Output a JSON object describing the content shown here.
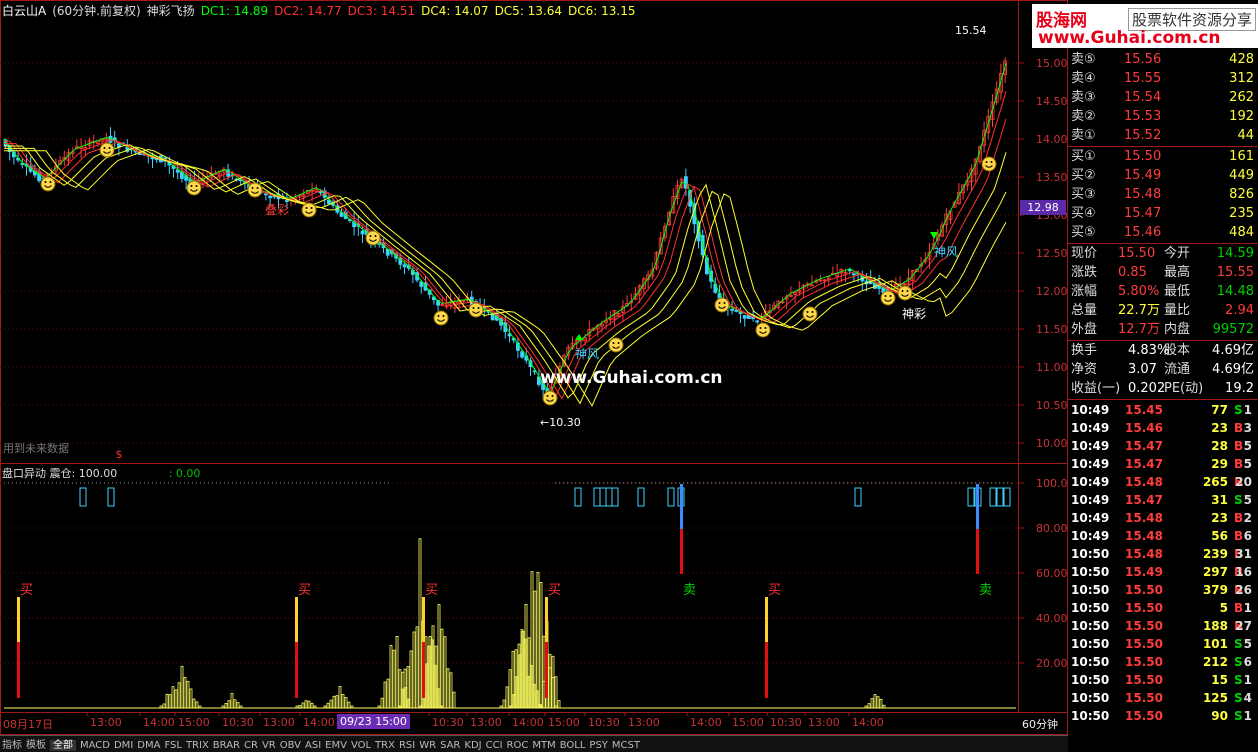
{
  "title": {
    "stock": "白云山A",
    "period": "(60分钟.前复权)",
    "indicator": "神彩飞扬",
    "dc": [
      {
        "label": "DC1: 14.89",
        "color": "#00ff00"
      },
      {
        "label": "DC2: 14.77",
        "color": "#ff3030"
      },
      {
        "label": "DC3: 14.51",
        "color": "#ff3030"
      },
      {
        "label": "DC4: 14.07",
        "color": "#ffff30"
      },
      {
        "label": "DC5: 13.64",
        "color": "#ffff30"
      },
      {
        "label": "DC6: 13.15",
        "color": "#ffff30"
      }
    ]
  },
  "price_axis": [
    "15.00",
    "14.50",
    "14.00",
    "13.50",
    "13.00",
    "12.50",
    "12.00",
    "11.50",
    "11.00",
    "10.50",
    "10.00"
  ],
  "current_price_tag": "12.98",
  "high_marker": "15.54",
  "low_marker": "←10.30",
  "chart_labels": {
    "label1": "叠彩",
    "label2": "神风",
    "label3": "神风",
    "label4": "神彩",
    "warn": "用到未来数据",
    "watermark": "www.Guhai.com.cn",
    "dollar": "$"
  },
  "indicator_panel": {
    "name": "盘口异动",
    "param": "震仓: 100.00",
    "val2": ": 0.00",
    "axis": [
      "100.00",
      "80.00",
      "60.00",
      "40.00",
      "20.00"
    ],
    "signals": [
      {
        "text": "买",
        "color": "#ff3030",
        "type": "buy"
      },
      {
        "text": "买",
        "color": "#ff3030",
        "type": "buy"
      },
      {
        "text": "买",
        "color": "#ff3030",
        "type": "buy"
      },
      {
        "text": "买",
        "color": "#ff3030",
        "type": "buy"
      },
      {
        "text": "卖",
        "color": "#00d000",
        "type": "sell"
      },
      {
        "text": "买",
        "color": "#ff3030",
        "type": "buy"
      },
      {
        "text": "卖",
        "color": "#00d000",
        "type": "sell"
      }
    ]
  },
  "time_axis": {
    "first": "08月17日",
    "labels": [
      "13:00",
      "14:00",
      "15:00",
      "10:30",
      "13:00",
      "14:00",
      "15:00",
      "10:30",
      "13:00",
      "14:00",
      "15:00",
      "10:30",
      "13:00",
      "14:00",
      "15:00",
      "10:30",
      "13:00",
      "14:00"
    ],
    "highlight": "09/23 15:00",
    "timeframe": "60分钟"
  },
  "bottom_tabs": [
    "指标",
    "模板",
    "全部",
    "MACD",
    "DMI",
    "DMA",
    "FSL",
    "TRIX",
    "BRAR",
    "CR",
    "VR",
    "OBV",
    "ASI",
    "EMV",
    "VOL",
    "TRX",
    "RSI",
    "WR",
    "SAR",
    "KDJ",
    "CCI",
    "ROC",
    "MTM",
    "BOLL",
    "PSY",
    "MCST"
  ],
  "logo": {
    "line1": "股海网",
    "line2": "股票软件资源分享",
    "line3": "www.Guhai.com.cn"
  },
  "order_book": {
    "sell": [
      {
        "label": "卖⑤",
        "price": "15.56",
        "vol": "428"
      },
      {
        "label": "卖④",
        "price": "15.55",
        "vol": "312"
      },
      {
        "label": "卖③",
        "price": "15.54",
        "vol": "262"
      },
      {
        "label": "卖②",
        "price": "15.53",
        "vol": "192"
      },
      {
        "label": "卖①",
        "price": "15.52",
        "vol": "44"
      }
    ],
    "buy": [
      {
        "label": "买①",
        "price": "15.50",
        "vol": "161"
      },
      {
        "label": "买②",
        "price": "15.49",
        "vol": "449"
      },
      {
        "label": "买③",
        "price": "15.48",
        "vol": "826"
      },
      {
        "label": "买④",
        "price": "15.47",
        "vol": "235"
      },
      {
        "label": "买⑤",
        "price": "15.46",
        "vol": "484"
      }
    ]
  },
  "quote": [
    {
      "k1": "现价",
      "v1": "15.50",
      "k2": "今开",
      "v2": "14.59",
      "c1": "#ff3c3c",
      "c2": "#00d000"
    },
    {
      "k1": "涨跌",
      "v1": "0.85",
      "k2": "最高",
      "v2": "15.55",
      "c1": "#ff3c3c",
      "c2": "#ff3c3c"
    },
    {
      "k1": "涨幅",
      "v1": "5.80%",
      "k2": "最低",
      "v2": "14.48",
      "c1": "#ff3c3c",
      "c2": "#00d000"
    },
    {
      "k1": "总量",
      "v1": "22.7万",
      "k2": "量比",
      "v2": "2.94",
      "c1": "#ffff40",
      "c2": "#ff3c3c"
    },
    {
      "k1": "外盘",
      "v1": "12.7万",
      "k2": "内盘",
      "v2": "99572",
      "c1": "#ff3c3c",
      "c2": "#00d000"
    }
  ],
  "fundamentals": [
    {
      "k1": "换手",
      "v1": "4.83%",
      "k2": "股本",
      "v2": "4.69亿"
    },
    {
      "k1": "净资",
      "v1": "3.07",
      "k2": "流通",
      "v2": "4.69亿"
    },
    {
      "k1": "收益(一)",
      "v1": "0.202",
      "k2": "PE(动)",
      "v2": "19.2"
    }
  ],
  "ticks": [
    {
      "time": "10:49",
      "price": "15.45",
      "vol": "77",
      "bs": "S",
      "n": "1"
    },
    {
      "time": "10:49",
      "price": "15.46",
      "vol": "23",
      "bs": "B",
      "n": "3"
    },
    {
      "time": "10:49",
      "price": "15.47",
      "vol": "28",
      "bs": "B",
      "n": "5"
    },
    {
      "time": "10:49",
      "price": "15.47",
      "vol": "29",
      "bs": "B",
      "n": "5"
    },
    {
      "time": "10:49",
      "price": "15.48",
      "vol": "265",
      "bs": "B",
      "n": "20"
    },
    {
      "time": "10:49",
      "price": "15.47",
      "vol": "31",
      "bs": "S",
      "n": "5"
    },
    {
      "time": "10:49",
      "price": "15.48",
      "vol": "23",
      "bs": "B",
      "n": "2"
    },
    {
      "time": "10:49",
      "price": "15.48",
      "vol": "56",
      "bs": "B",
      "n": "6"
    },
    {
      "time": "10:50",
      "price": "15.48",
      "vol": "239",
      "bs": "B",
      "n": "31"
    },
    {
      "time": "10:50",
      "price": "15.49",
      "vol": "297",
      "bs": "B",
      "n": "16"
    },
    {
      "time": "10:50",
      "price": "15.50",
      "vol": "379",
      "bs": "B",
      "n": "26"
    },
    {
      "time": "10:50",
      "price": "15.50",
      "vol": "5",
      "bs": "B",
      "n": "1"
    },
    {
      "time": "10:50",
      "price": "15.50",
      "vol": "188",
      "bs": "B",
      "n": "27"
    },
    {
      "time": "10:50",
      "price": "15.50",
      "vol": "101",
      "bs": "S",
      "n": "5"
    },
    {
      "time": "10:50",
      "price": "15.50",
      "vol": "212",
      "bs": "S",
      "n": "6"
    },
    {
      "time": "10:50",
      "price": "15.50",
      "vol": "15",
      "bs": "S",
      "n": "1"
    },
    {
      "time": "10:50",
      "price": "15.50",
      "vol": "125",
      "bs": "S",
      "n": "4"
    },
    {
      "time": "10:50",
      "price": "15.50",
      "vol": "90",
      "bs": "S",
      "n": "1"
    }
  ]
}
